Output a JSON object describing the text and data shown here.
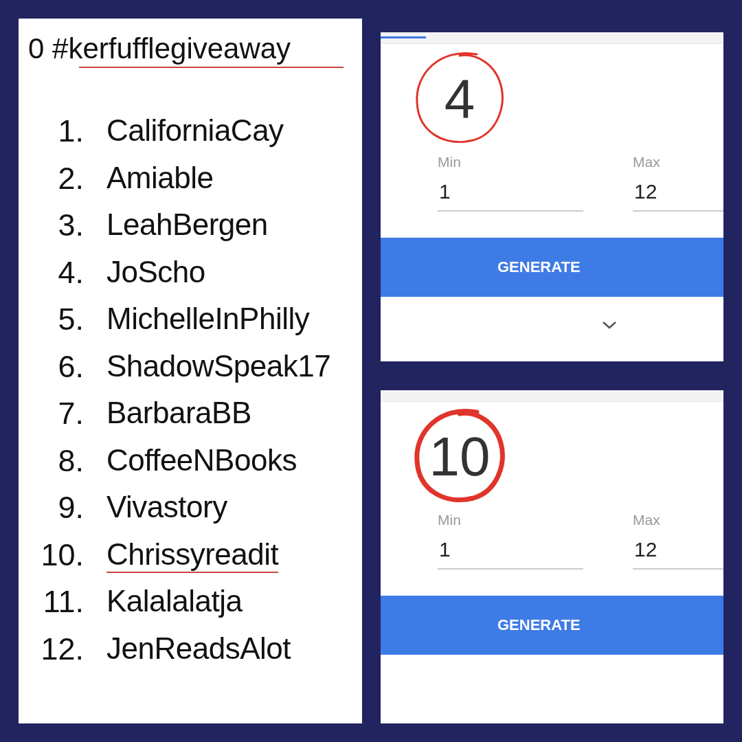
{
  "note": {
    "title": {
      "text": "0 #kerfufflegiveaway",
      "underlined": true
    },
    "entries": [
      {
        "number": "1.",
        "name": "CaliforniaCay",
        "underlined": false
      },
      {
        "number": "2.",
        "name": "Amiable",
        "underlined": false
      },
      {
        "number": "3.",
        "name": "LeahBergen",
        "underlined": false
      },
      {
        "number": "4.",
        "name": "JoScho",
        "underlined": false
      },
      {
        "number": "5.",
        "name": "MichelleInPhilly",
        "underlined": false
      },
      {
        "number": "6.",
        "name": "ShadowSpeak17",
        "underlined": false
      },
      {
        "number": "7.",
        "name": "BarbaraBB",
        "underlined": false
      },
      {
        "number": "8.",
        "name": "CoffeeNBooks",
        "underlined": false
      },
      {
        "number": "9.",
        "name": "Vivastory",
        "underlined": false
      },
      {
        "number": "10.",
        "name": "Chrissyreadit",
        "underlined": true
      },
      {
        "number": "11.",
        "name": "Kalalalatja",
        "underlined": false
      },
      {
        "number": "12.",
        "name": "JenReadsAlot",
        "underlined": false
      }
    ]
  },
  "generators": [
    {
      "tab_indicator": true,
      "result": "4",
      "circle_bold": false,
      "min_label": "Min",
      "min": "1",
      "max_label": "Max",
      "max": "12",
      "button": "GENERATE",
      "show_more": true
    },
    {
      "tab_indicator": false,
      "result": "10",
      "circle_bold": true,
      "min_label": "Min",
      "min": "1",
      "max_label": "Max",
      "max": "12",
      "button": "GENERATE",
      "show_more": false
    }
  ]
}
